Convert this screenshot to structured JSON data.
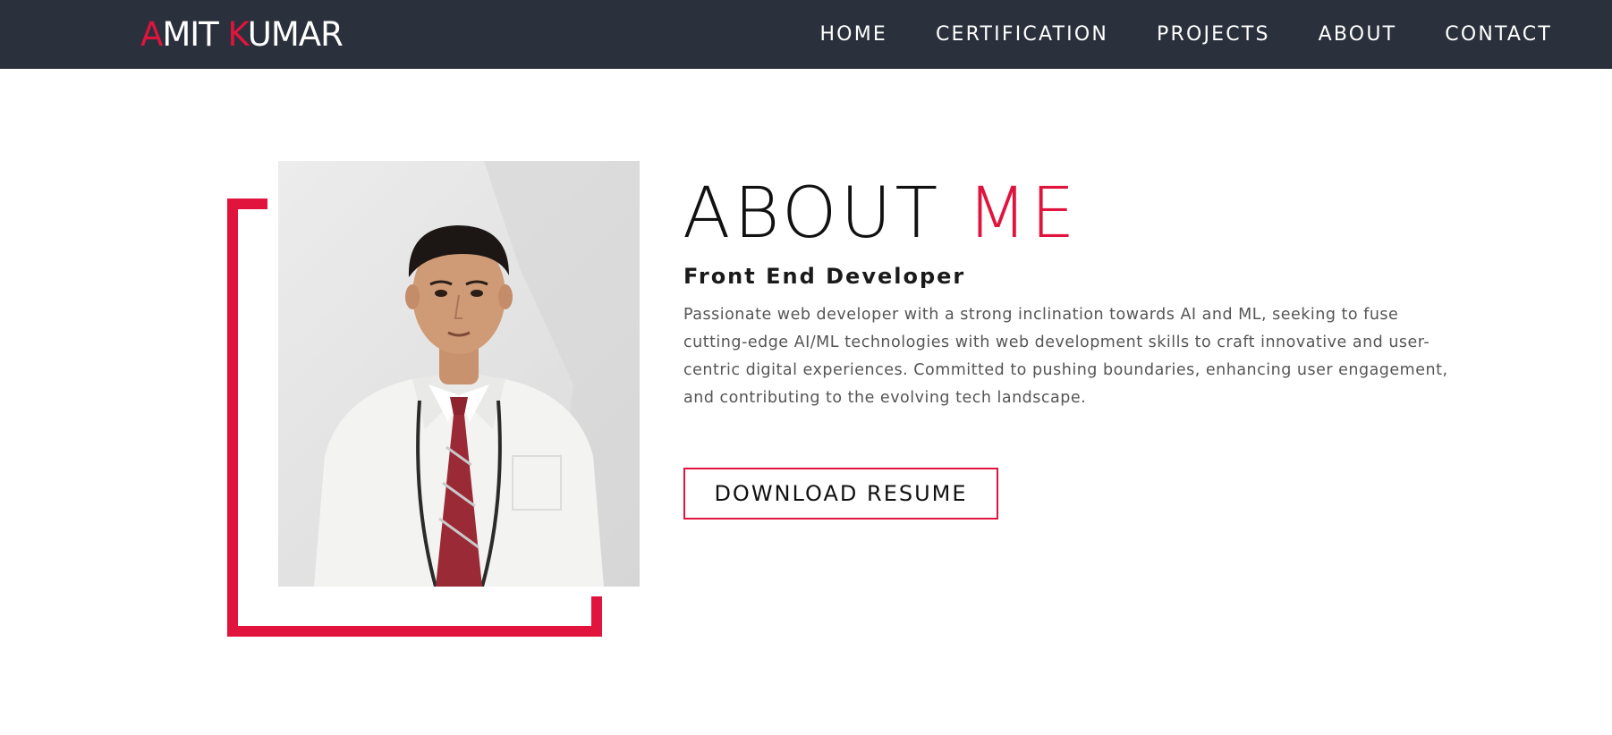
{
  "navbar": {
    "logo": {
      "first_initial": "A",
      "first_rest": "MIT ",
      "last_initial": "K",
      "last_rest": "UMAR"
    },
    "links": {
      "home": "HOME",
      "certification": "CERTIFICATION",
      "projects": "PROJECTS",
      "about": "ABOUT",
      "contact": "CONTACT"
    }
  },
  "about": {
    "heading_main": "ABOUT ",
    "heading_accent": "ME",
    "subtitle": "Front End Developer",
    "bio": "Passionate web developer with a strong inclination towards AI and ML, seeking to fuse cutting-edge AI/ML technologies with web development skills to craft innovative and user-centric digital experiences. Committed to pushing boundaries, enhancing user engagement, and contributing to the evolving tech landscape.",
    "resume_button": "DOWNLOAD RESUME"
  },
  "colors": {
    "accent": "#e0143c",
    "navbar_bg": "#2b313c",
    "text_dark": "#111111",
    "text_muted": "#555555"
  }
}
